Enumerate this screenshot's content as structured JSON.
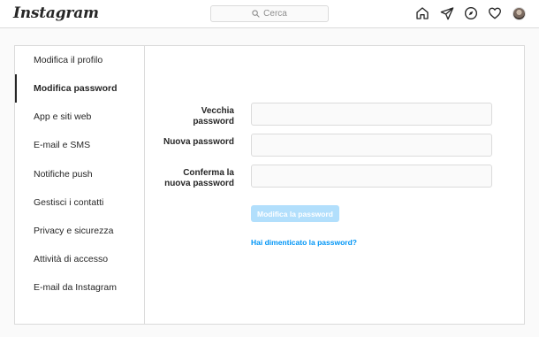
{
  "topbar": {
    "logo": "Instagram",
    "search": {
      "placeholder": "Cerca"
    },
    "nav_icons": [
      "home-icon",
      "direct-icon",
      "explore-icon",
      "activity-icon",
      "avatar"
    ]
  },
  "sidebar": {
    "items": [
      {
        "label": "Modifica il profilo",
        "active": false
      },
      {
        "label": "Modifica password",
        "active": true
      },
      {
        "label": "App e siti web",
        "active": false
      },
      {
        "label": "E-mail e SMS",
        "active": false
      },
      {
        "label": "Notifiche push",
        "active": false
      },
      {
        "label": "Gestisci i contatti",
        "active": false
      },
      {
        "label": "Privacy e sicurezza",
        "active": false
      },
      {
        "label": "Attività di accesso",
        "active": false
      },
      {
        "label": "E-mail da Instagram",
        "active": false
      }
    ]
  },
  "form": {
    "old_password": {
      "label_line1": "Vecchia",
      "label_line2": "password",
      "value": ""
    },
    "new_password": {
      "label": "Nuova password",
      "value": ""
    },
    "confirm_password": {
      "label_line1": "Conferma la",
      "label_line2": "nuova password",
      "value": ""
    },
    "submit_label": "Modifica la password",
    "forgot_link": "Hai dimenticato la password?"
  },
  "colors": {
    "button_disabled": "#b2dffc",
    "link": "#0095f6",
    "border": "#dbdbdb",
    "background": "#fafafa"
  }
}
